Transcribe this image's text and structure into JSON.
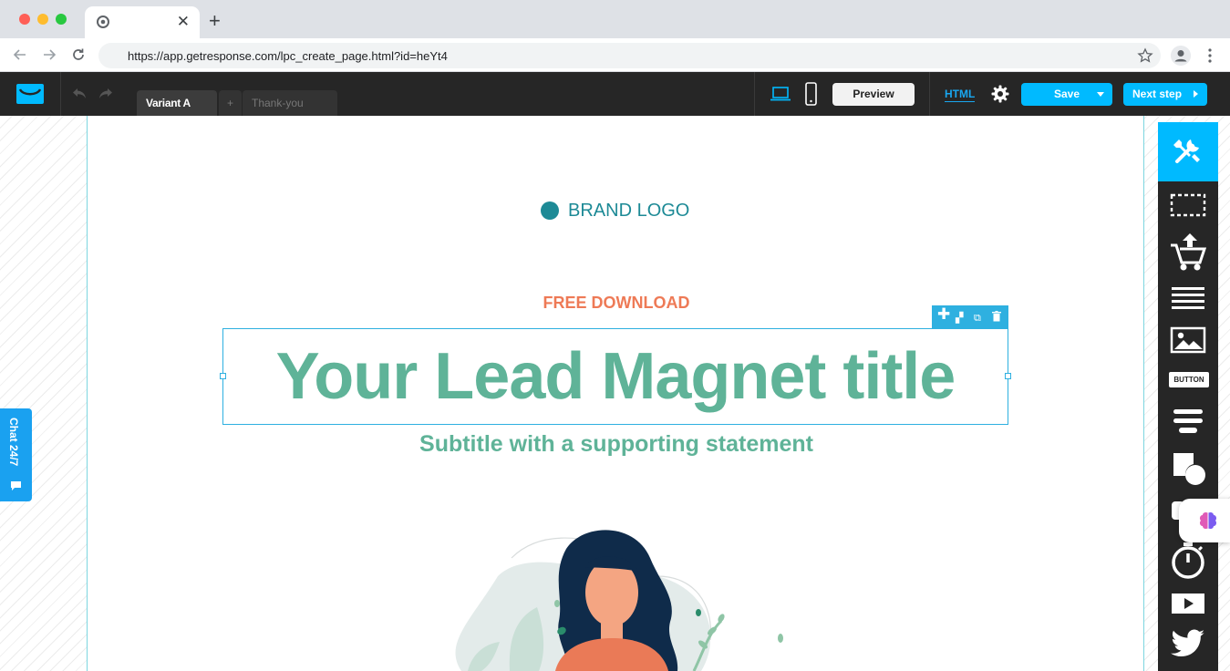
{
  "browser": {
    "tab_close": "✕",
    "new_tab": "+",
    "url": "https://app.getresponse.com/lpc_create_page.html?id=heYt4"
  },
  "header": {
    "variant_tabs": [
      {
        "label": "Variant A"
      },
      {
        "label": "+"
      },
      {
        "label": "Thank-you page"
      }
    ],
    "preview_label": "Preview",
    "html_label": "HTML",
    "save_label": "Save",
    "next_label": "Next step"
  },
  "canvas": {
    "brand_logo": "BRAND LOGO",
    "eyebrow": "FREE DOWNLOAD",
    "title": "Your Lead Magnet title",
    "subtitle": "Subtitle with a supporting statement",
    "chat_label": "Chat 24/7"
  },
  "rail": {
    "button_chip": "BUTTON",
    "items": [
      "tools-icon",
      "section-icon",
      "cart-icon",
      "text-icon",
      "image-icon",
      "button-icon",
      "form-icon",
      "shapes-icon",
      "video-chat-icon",
      "timer-icon",
      "video-icon",
      "twitter-icon"
    ]
  },
  "colors": {
    "accent": "#00baff",
    "title_green": "#5fb398",
    "brand_teal": "#1d8a96",
    "eyebrow_orange": "#ee7a56",
    "header_dark": "#262626"
  }
}
